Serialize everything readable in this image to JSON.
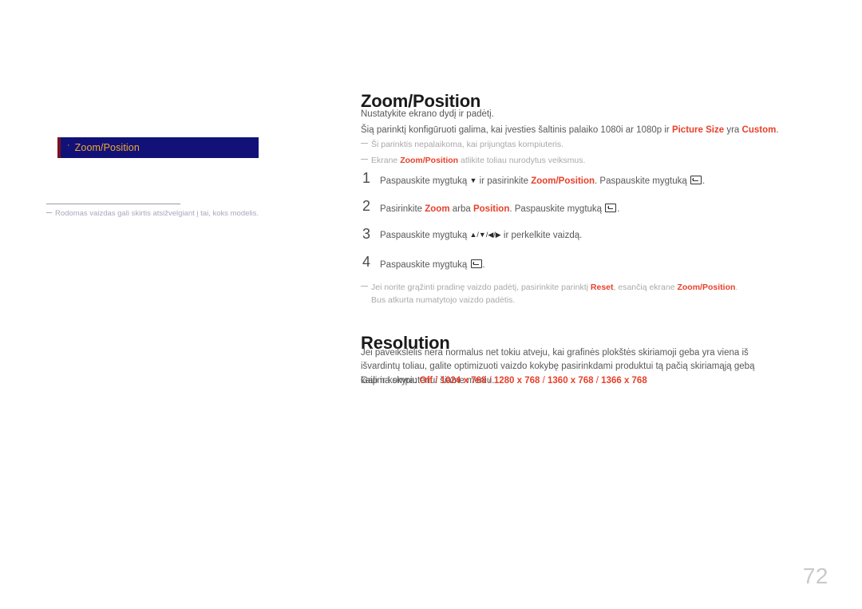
{
  "page": {
    "number": "72",
    "background": "#ffffff",
    "accent_red": "#e8402a",
    "menu_bg": "#111178",
    "menu_text": "#f0a830"
  },
  "sidebar": {
    "items": [
      {
        "bullet": "·",
        "label": "Zoom/Position"
      }
    ],
    "note": "Rodomas vaizdas gali skirtis atsižvelgiant į tai, koks modelis."
  },
  "sections": [
    {
      "id": "zoom-position",
      "title": "Zoom/Position",
      "descriptions": [
        {
          "parts": [
            {
              "t": "Nustatykite ekrano dydį ir padėtį.",
              "s": "normal"
            }
          ]
        },
        {
          "parts": [
            {
              "t": "Šią parinktį konfigūruoti galima, kai įvesties šaltinis palaiko 1080i ar 1080p ir ",
              "s": "normal"
            },
            {
              "t": "Picture Size",
              "s": "red-bold"
            },
            {
              "t": " yra ",
              "s": "normal"
            },
            {
              "t": "Custom",
              "s": "red-bold"
            },
            {
              "t": ".",
              "s": "normal"
            }
          ]
        }
      ],
      "notes_top": [
        {
          "parts": [
            {
              "t": "Ši parinktis nepalaikoma, kai prijungtas kompiuteris.",
              "s": "normal"
            }
          ]
        },
        {
          "parts": [
            {
              "t": "Ekrane ",
              "s": "normal"
            },
            {
              "t": "Zoom/Position",
              "s": "red-bold"
            },
            {
              "t": " atlikite toliau nurodytus veiksmus.",
              "s": "normal"
            }
          ]
        }
      ],
      "steps": [
        {
          "num": "1",
          "parts": [
            {
              "t": "Paspauskite mygtuką ",
              "s": "normal"
            },
            {
              "t": "▼",
              "s": "glyph-arrow"
            },
            {
              "t": " ir pasirinkite ",
              "s": "normal"
            },
            {
              "t": "Zoom/Position",
              "s": "red-bold"
            },
            {
              "t": ". Paspauskite mygtuką ",
              "s": "normal"
            },
            {
              "t": "enter-button-icon",
              "s": "glyph-enter"
            },
            {
              "t": ".",
              "s": "normal"
            }
          ]
        },
        {
          "num": "2",
          "parts": [
            {
              "t": "Pasirinkite ",
              "s": "normal"
            },
            {
              "t": "Zoom",
              "s": "red-bold"
            },
            {
              "t": " arba ",
              "s": "normal"
            },
            {
              "t": "Position",
              "s": "red-bold"
            },
            {
              "t": ". Paspauskite mygtuką ",
              "s": "normal"
            },
            {
              "t": "enter-button-icon",
              "s": "glyph-enter"
            },
            {
              "t": ".",
              "s": "normal"
            }
          ]
        },
        {
          "num": "3",
          "parts": [
            {
              "t": "Paspauskite mygtuką ",
              "s": "normal"
            },
            {
              "t": "▲/▼/◀/▶",
              "s": "glyph-arrow"
            },
            {
              "t": " ir perkelkite vaizdą.",
              "s": "normal"
            }
          ]
        },
        {
          "num": "4",
          "parts": [
            {
              "t": "Paspauskite mygtuką ",
              "s": "normal"
            },
            {
              "t": "enter-button-icon",
              "s": "glyph-enter"
            },
            {
              "t": ".",
              "s": "normal"
            }
          ]
        }
      ],
      "note_bottom": {
        "line1_parts": [
          {
            "t": "Jei norite grąžinti pradinę vaizdo padėtį, pasirinkite parinktį ",
            "s": "normal"
          },
          {
            "t": "Reset",
            "s": "red-bold"
          },
          {
            "t": ", esančią ekrane ",
            "s": "normal"
          },
          {
            "t": "Zoom/Position",
            "s": "red-bold"
          },
          {
            "t": ".",
            "s": "normal"
          }
        ],
        "line2": "Bus atkurta numatytojo vaizdo padėtis."
      }
    },
    {
      "id": "resolution",
      "title": "Resolution",
      "paragraph": "Jei paveikslėlis nėra normalus net tokiu atveju, kai grafinės plokštės skiriamoji geba yra viena iš išvardintų toliau, galite optimizuoti vaizdo kokybę pasirinkdami produktui tą pačią skiriamąją gebą kaip ir kompiuteriui šiame meniu.",
      "available_label": "Galima skyra: ",
      "available_options": [
        "Off",
        "1024 x 768",
        "1280 x 768",
        "1360 x 768",
        "1366 x 768"
      ],
      "available_separator": " / "
    }
  ]
}
